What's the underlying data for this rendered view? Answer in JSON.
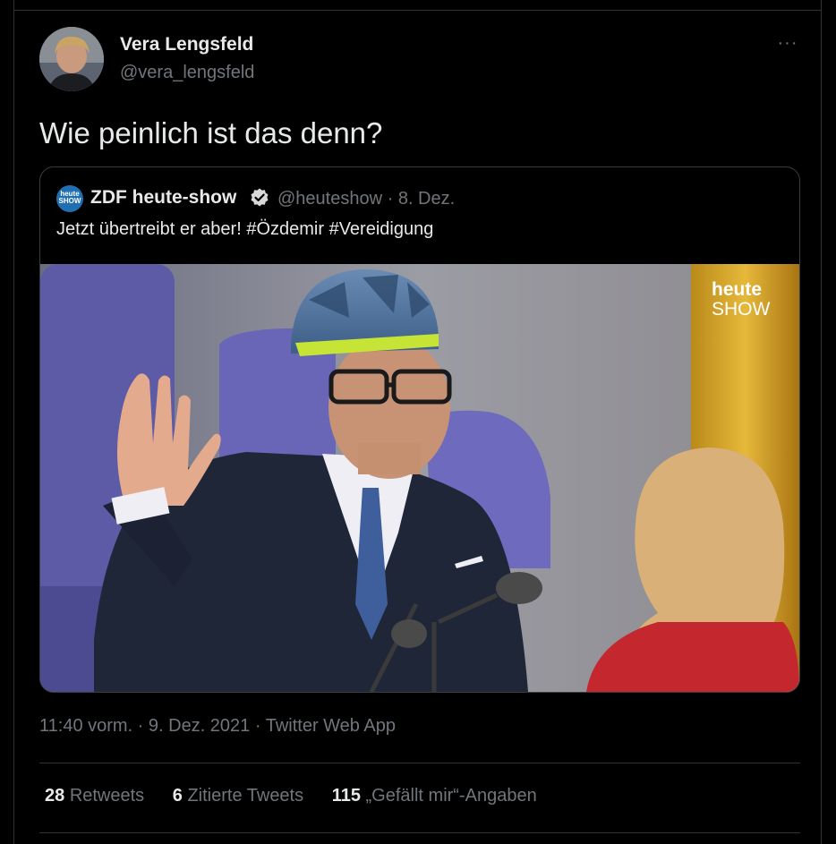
{
  "tweet": {
    "author": {
      "name": "Vera Lengsfeld",
      "handle": "@vera_lengsfeld"
    },
    "more_label": "···",
    "text": "Wie peinlich ist das denn?",
    "quoted": {
      "avatar_text": "heute SHOW",
      "name": "ZDF heute-show",
      "handle_date": "@heuteshow · 8. Dez.",
      "text": "Jetzt übertreibt er aber! #Özdemir #Vereidigung",
      "image_watermark_line1": "heute",
      "image_watermark_line2": "SHOW"
    },
    "timestamp": "11:40 vorm. · 9. Dez. 2021 · Twitter Web App",
    "stats": [
      {
        "count": "28",
        "label": "Retweets"
      },
      {
        "count": "6",
        "label": "Zitierte Tweets"
      },
      {
        "count": "115",
        "label": "„Gefällt mir“-Angaben"
      }
    ]
  },
  "colors": {
    "background": "#000000",
    "secondary_text": "#71767b",
    "primary_text": "#e7e9ea",
    "verified": "#d9d9d9"
  }
}
